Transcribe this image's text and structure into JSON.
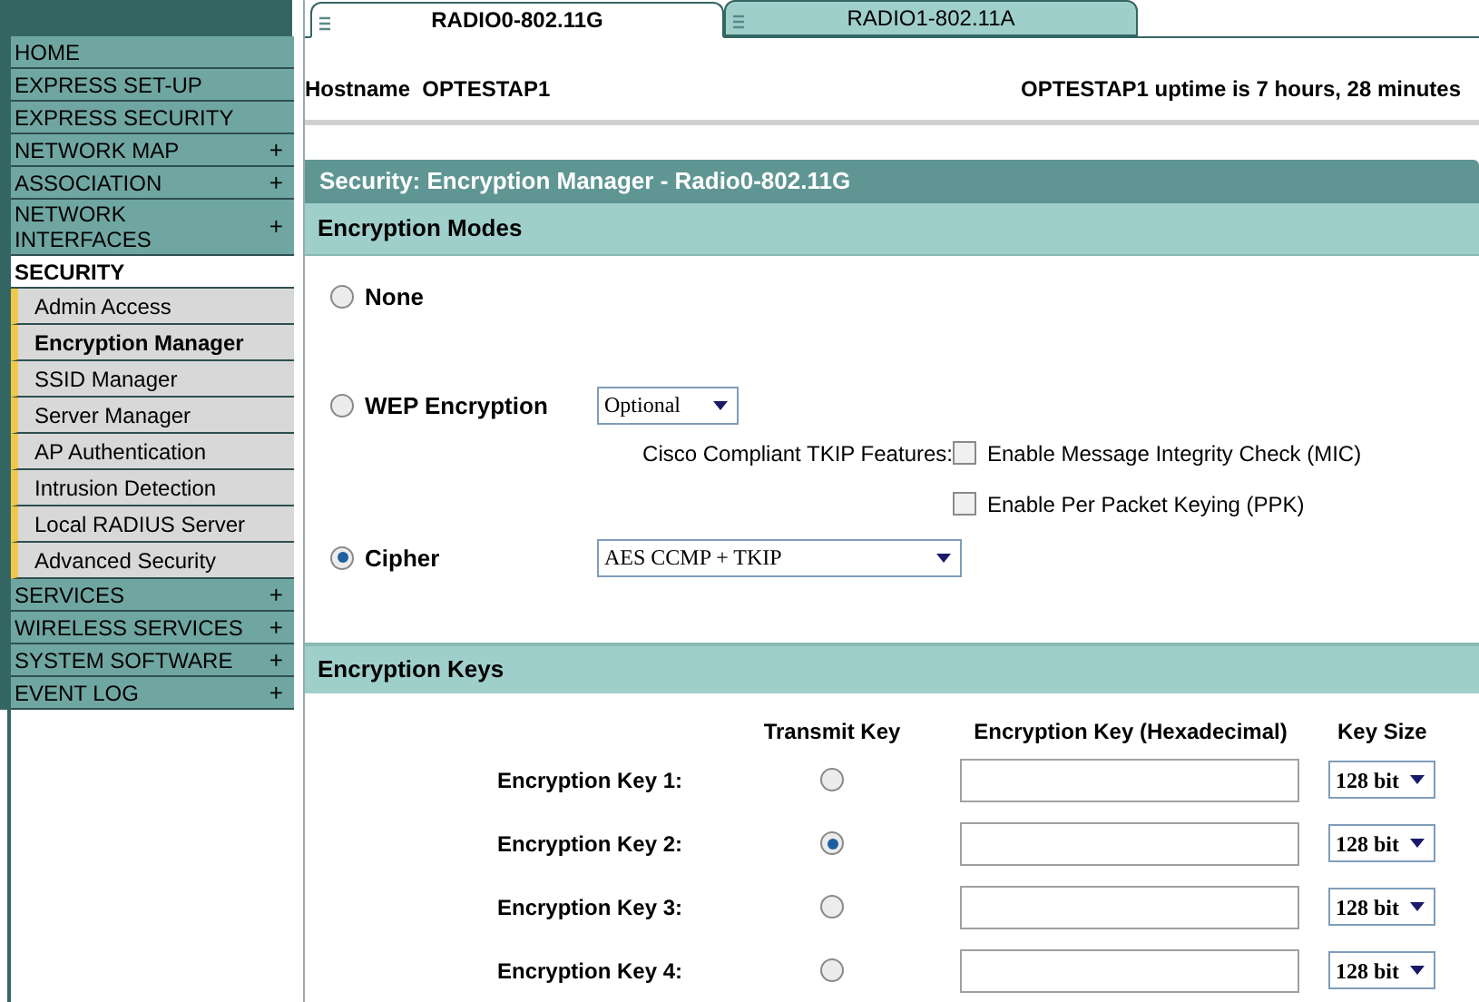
{
  "sidebar": {
    "items": [
      {
        "label": "HOME",
        "kind": "section",
        "selected": false
      },
      {
        "label": "EXPRESS SET-UP",
        "kind": "section",
        "selected": false
      },
      {
        "label": "EXPRESS SECURITY",
        "kind": "section",
        "selected": false
      },
      {
        "label": "NETWORK MAP",
        "kind": "section",
        "selected": false,
        "expander": "+"
      },
      {
        "label": "ASSOCIATION",
        "kind": "section",
        "selected": false,
        "expander": "+"
      },
      {
        "label": "NETWORK INTERFACES",
        "kind": "section",
        "selected": false,
        "expander": "+"
      },
      {
        "label": "SECURITY",
        "kind": "section",
        "selected": true
      },
      {
        "label": "Admin Access",
        "kind": "subitem",
        "selected": false
      },
      {
        "label": "Encryption Manager",
        "kind": "subitem",
        "selected": true
      },
      {
        "label": "SSID Manager",
        "kind": "subitem",
        "selected": false
      },
      {
        "label": "Server Manager",
        "kind": "subitem",
        "selected": false
      },
      {
        "label": "AP Authentication",
        "kind": "subitem",
        "selected": false
      },
      {
        "label": "Intrusion Detection",
        "kind": "subitem",
        "selected": false
      },
      {
        "label": "Local RADIUS Server",
        "kind": "subitem",
        "selected": false
      },
      {
        "label": "Advanced Security",
        "kind": "subitem",
        "selected": false
      },
      {
        "label": "SERVICES",
        "kind": "section",
        "selected": false,
        "expander": "+"
      },
      {
        "label": "WIRELESS SERVICES",
        "kind": "section",
        "selected": false,
        "expander": "+"
      },
      {
        "label": "SYSTEM SOFTWARE",
        "kind": "section",
        "selected": false,
        "expander": "+"
      },
      {
        "label": "EVENT LOG",
        "kind": "section",
        "selected": false,
        "expander": "+"
      }
    ]
  },
  "tabs": [
    {
      "label": "RADIO0-802.11G",
      "selected": true
    },
    {
      "label": "RADIO1-802.11A",
      "selected": false
    }
  ],
  "host": {
    "label": "Hostname",
    "name": "OPTESTAP1",
    "uptime": "OPTESTAP1 uptime is 7 hours, 28 minutes"
  },
  "panel_title": "Security: Encryption Manager - Radio0-802.11G",
  "encryption_modes": {
    "title": "Encryption Modes",
    "modes": [
      {
        "label": "None",
        "selected": false
      },
      {
        "label": "WEP Encryption",
        "selected": false,
        "select_value": "Optional"
      },
      {
        "label": "Cipher",
        "selected": true,
        "select_value": "AES CCMP + TKIP"
      }
    ],
    "tkip": {
      "label": "Cisco Compliant TKIP Features:",
      "options": [
        {
          "label": "Enable Message Integrity Check (MIC)",
          "checked": false
        },
        {
          "label": "Enable Per Packet Keying (PPK)",
          "checked": false
        }
      ]
    }
  },
  "encryption_keys": {
    "title": "Encryption Keys",
    "columns": [
      "Transmit Key",
      "Encryption Key (Hexadecimal)",
      "Key Size"
    ],
    "rows": [
      {
        "label": "Encryption Key 1:",
        "selected": false,
        "size": "128 bit"
      },
      {
        "label": "Encryption Key 2:",
        "selected": true,
        "size": "128 bit"
      },
      {
        "label": "Encryption Key 3:",
        "selected": false,
        "size": "128 bit"
      },
      {
        "label": "Encryption Key 4:",
        "selected": false,
        "size": "128 bit"
      }
    ]
  }
}
